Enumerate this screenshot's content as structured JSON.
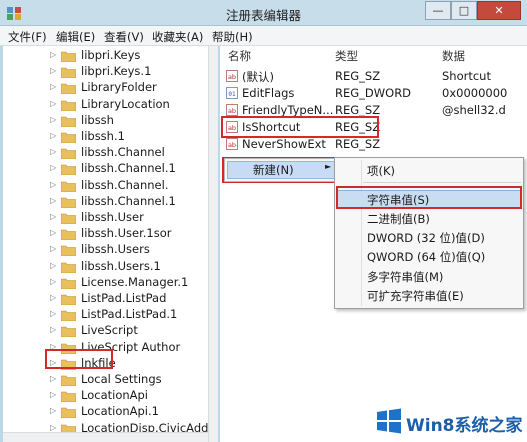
{
  "window": {
    "title": "注册表编辑器",
    "min": "—",
    "max": "□",
    "close": "✕"
  },
  "menubar": [
    "文件(F)",
    "编辑(E)",
    "查看(V)",
    "收藏夹(A)",
    "帮助(H)"
  ],
  "tree": [
    {
      "label": "libpri.Keys",
      "arrow": "▷"
    },
    {
      "label": "libpri.Keys.1",
      "arrow": "▷"
    },
    {
      "label": "LibraryFolder",
      "arrow": "▷"
    },
    {
      "label": "LibraryLocation",
      "arrow": "▷"
    },
    {
      "label": "libssh",
      "arrow": "▷"
    },
    {
      "label": "libssh.1",
      "arrow": "▷"
    },
    {
      "label": "libssh.Channel",
      "arrow": "▷"
    },
    {
      "label": "libssh.Channel.1",
      "arrow": "▷"
    },
    {
      "label": "libssh.Channel.",
      "arrow": "▷"
    },
    {
      "label": "libssh.Channel.1",
      "arrow": "▷"
    },
    {
      "label": "libssh.User",
      "arrow": "▷"
    },
    {
      "label": "libssh.User.1sor",
      "arrow": "▷"
    },
    {
      "label": "libssh.Users",
      "arrow": "▷"
    },
    {
      "label": "libssh.Users.1",
      "arrow": "▷"
    },
    {
      "label": "License.Manager.1",
      "arrow": "▷"
    },
    {
      "label": "ListPad.ListPad",
      "arrow": "▷"
    },
    {
      "label": "ListPad.ListPad.1",
      "arrow": "▷"
    },
    {
      "label": "LiveScript",
      "arrow": "▷"
    },
    {
      "label": "LiveScript Author",
      "arrow": "▷"
    },
    {
      "label": "lnkfile",
      "arrow": "▷"
    },
    {
      "label": "Local Settings",
      "arrow": "▷"
    },
    {
      "label": "LocationApi",
      "arrow": "▷"
    },
    {
      "label": "LocationApi.1",
      "arrow": "▷"
    },
    {
      "label": "LocationDisp.CivicAddre",
      "arrow": "▷"
    }
  ],
  "list": {
    "headers": {
      "name": "名称",
      "type": "类型",
      "data": "数据"
    },
    "rows": [
      {
        "name": "(默认)",
        "type": "REG_SZ",
        "data": "Shortcut"
      },
      {
        "name": "EditFlags",
        "type": "REG_DWORD",
        "data": "0x0000000"
      },
      {
        "name": "FriendlyTypeN...",
        "type": "REG_SZ",
        "data": "@shell32.d"
      },
      {
        "name": "IsShortcut",
        "type": "REG_SZ",
        "data": ""
      },
      {
        "name": "NeverShowExt",
        "type": "REG_SZ",
        "data": ""
      }
    ]
  },
  "context_menu": {
    "new_label": "新建(N)",
    "arrow": "►"
  },
  "submenu": {
    "key": "项(K)",
    "items": [
      "字符串值(S)",
      "二进制值(B)",
      "DWORD (32 位)值(D)",
      "QWORD (64 位)值(Q)",
      "多字符串值(M)",
      "可扩充字符串值(E)"
    ]
  },
  "logo": {
    "text": "Win8系统之家"
  },
  "colors": {
    "highlight_red": "#d02a2a",
    "menu_highlight": "#c9dcf2",
    "folder": "#e8c15a",
    "logo_blue": "#1b5fa8"
  }
}
